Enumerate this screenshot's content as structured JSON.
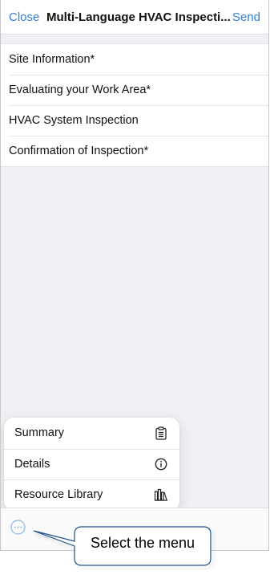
{
  "navbar": {
    "close_label": "Close",
    "title": "Multi-Language HVAC Inspecti...",
    "send_label": "Send"
  },
  "sections": [
    {
      "label": "Site Information*"
    },
    {
      "label": "Evaluating your Work Area*"
    },
    {
      "label": "HVAC System Inspection"
    },
    {
      "label": "Confirmation of Inspection*"
    }
  ],
  "menu": {
    "items": [
      {
        "label": "Summary",
        "icon": "clipboard-icon"
      },
      {
        "label": "Details",
        "icon": "info-icon"
      },
      {
        "label": "Resource Library",
        "icon": "library-icon"
      }
    ]
  },
  "toolbar": {
    "more_icon": "more-icon"
  },
  "callout": {
    "text": "Select the menu"
  },
  "colors": {
    "accent": "#2f7dd1",
    "background": "#efeff4"
  }
}
